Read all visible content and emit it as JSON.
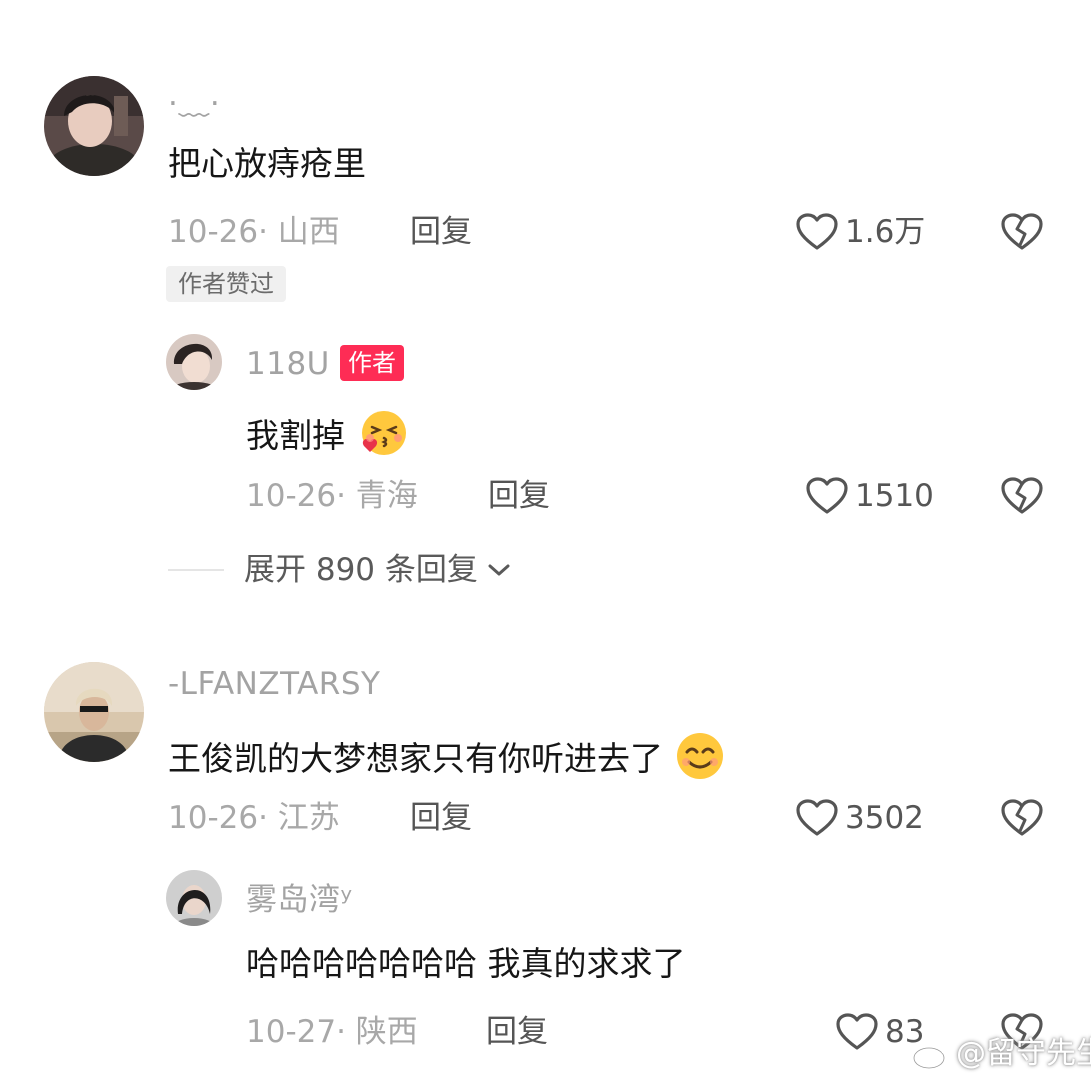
{
  "comments": [
    {
      "username": "·﹏·",
      "text": "把心放痔疮里",
      "date_location": "10-26· 山西",
      "reply_label": "回复",
      "likes": "1.6万",
      "badge": "作者赞过",
      "replies": [
        {
          "username": "118U",
          "author_badge": "作者",
          "text": "我割掉",
          "emoji": "face-blowing-kiss",
          "date_location": "10-26· 青海",
          "reply_label": "回复",
          "likes": "1510"
        }
      ],
      "expand_label": "展开 890 条回复"
    },
    {
      "username": "-LFANZTARSY",
      "text": "王俊凯的大梦想家只有你听进去了",
      "emoji": "smiling-face",
      "date_location": "10-26· 江苏",
      "reply_label": "回复",
      "likes": "3502",
      "replies": [
        {
          "username": "雾岛湾ʸ",
          "text": "哈哈哈哈哈哈哈 我真的求求了",
          "date_location": "10-27· 陕西",
          "reply_label": "回复",
          "likes": "83"
        }
      ]
    }
  ],
  "watermark": {
    "text": "@留守先生",
    "icon": "weibo-icon"
  },
  "icons": {
    "like": "heart-outline-icon",
    "dislike": "broken-heart-icon",
    "expand": "chevron-down-icon"
  },
  "colors": {
    "author_badge": "#fe2c55",
    "muted_text": "#a8a8a8",
    "body_text": "#161616"
  }
}
